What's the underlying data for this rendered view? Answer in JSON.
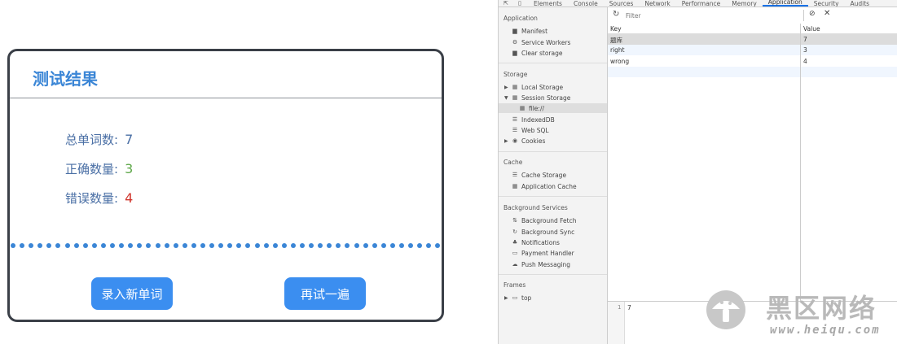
{
  "card": {
    "title": "测试结果",
    "stats": [
      {
        "label": "总单词数:",
        "value": "7",
        "color": "#4a6fa5"
      },
      {
        "label": "正确数量:",
        "value": "3",
        "color": "#5fa84a"
      },
      {
        "label": "错误数量:",
        "value": "4",
        "color": "#d0342c"
      }
    ],
    "buttons": {
      "add_word": "录入新单词",
      "retry": "再试一遍"
    }
  },
  "devtools": {
    "tabs": [
      "Elements",
      "Console",
      "Sources",
      "Network",
      "Performance",
      "Memory",
      "Application",
      "Security",
      "Audits"
    ],
    "active_tab": "Application",
    "sidebar": {
      "application_title": "Application",
      "application_items": [
        "Manifest",
        "Service Workers",
        "Clear storage"
      ],
      "storage_title": "Storage",
      "storage_items": [
        "Local Storage",
        "Session Storage",
        "file://",
        "IndexedDB",
        "Web SQL",
        "Cookies"
      ],
      "cache_title": "Cache",
      "cache_items": [
        "Cache Storage",
        "Application Cache"
      ],
      "background_title": "Background Services",
      "background_items": [
        "Background Fetch",
        "Background Sync",
        "Notifications",
        "Payment Handler",
        "Push Messaging"
      ],
      "frames_title": "Frames",
      "frames_items": [
        "top"
      ]
    },
    "filter_placeholder": "Filter",
    "table": {
      "headers": {
        "key": "Key",
        "value": "Value"
      },
      "rows": [
        {
          "key": "题库",
          "value": "7"
        },
        {
          "key": "right",
          "value": "3"
        },
        {
          "key": "wrong",
          "value": "4"
        }
      ]
    },
    "preview": {
      "line": "1",
      "value": "7"
    }
  },
  "watermark": {
    "title": "黑区网络",
    "url": "www.heiqu.com"
  }
}
